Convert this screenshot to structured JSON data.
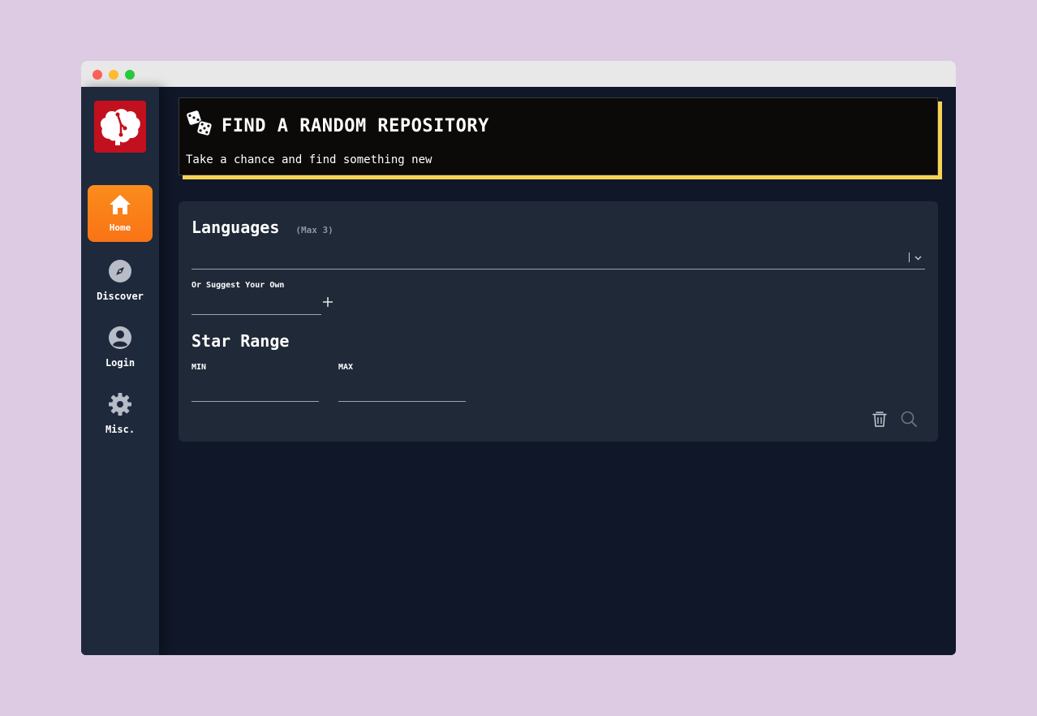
{
  "sidebar": {
    "items": [
      {
        "label": "Home",
        "icon": "home-icon",
        "active": true
      },
      {
        "label": "Discover",
        "icon": "compass-icon",
        "active": false
      },
      {
        "label": "Login",
        "icon": "user-circle-icon",
        "active": false
      },
      {
        "label": "Misc.",
        "icon": "gear-icon",
        "active": false
      }
    ]
  },
  "header": {
    "title": "FIND A RANDOM REPOSITORY",
    "subtitle": "Take a chance and find something new"
  },
  "form": {
    "languages_title": "Languages",
    "languages_hint": "(Max 3)",
    "languages_value": "",
    "suggest_label": "Or Suggest Your Own",
    "suggest_value": "",
    "star_range_title": "Star Range",
    "min_label": "MIN",
    "min_value": "",
    "max_label": "MAX",
    "max_value": ""
  },
  "colors": {
    "accent_orange": "#f97316",
    "header_shadow_yellow": "#f7d354",
    "logo_red": "#c2101f",
    "card_bg": "#1f2937",
    "page_bg": "#101729"
  }
}
